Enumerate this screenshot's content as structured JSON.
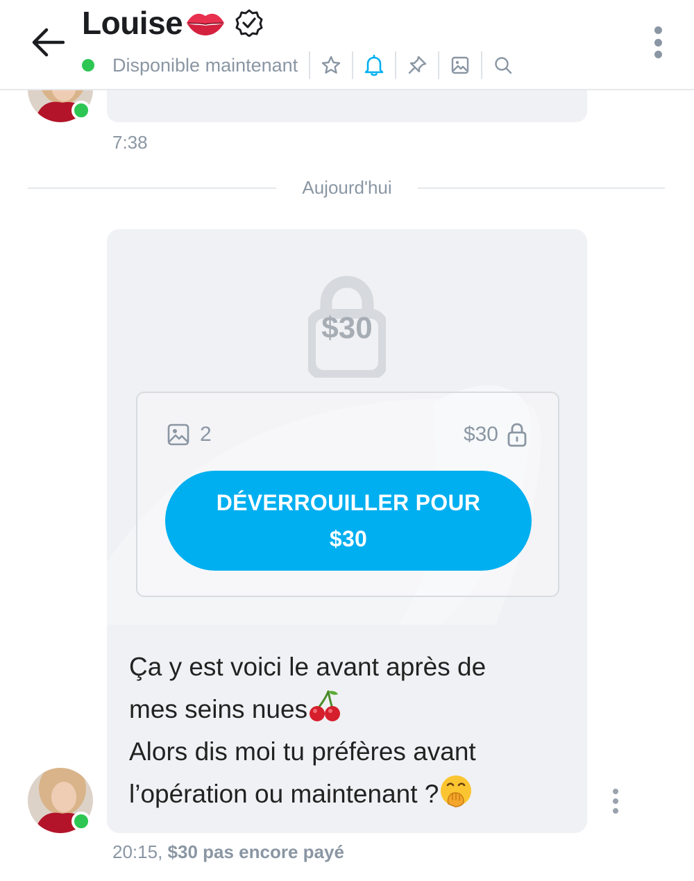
{
  "header": {
    "title": "Louise",
    "status": "Disponible maintenant",
    "icons": [
      "star-icon",
      "bell-icon",
      "pin-icon",
      "image-icon",
      "search-icon"
    ],
    "accent": "#00aff0"
  },
  "conversation": {
    "previous_time": "7:38",
    "date_divider": "Aujourd'hui",
    "locked_message": {
      "lock_price": "$30",
      "media_count": "2",
      "price": "$30",
      "unlock_label": "DÉVERROUILLER POUR $30"
    },
    "message_lines": [
      "Ça y est voici le avant après de",
      "mes seins nues",
      "Alors dis moi tu préfères avant",
      "l’opération ou maintenant ?"
    ],
    "time": "20:15,",
    "payment_status": "$30 pas encore payé"
  }
}
